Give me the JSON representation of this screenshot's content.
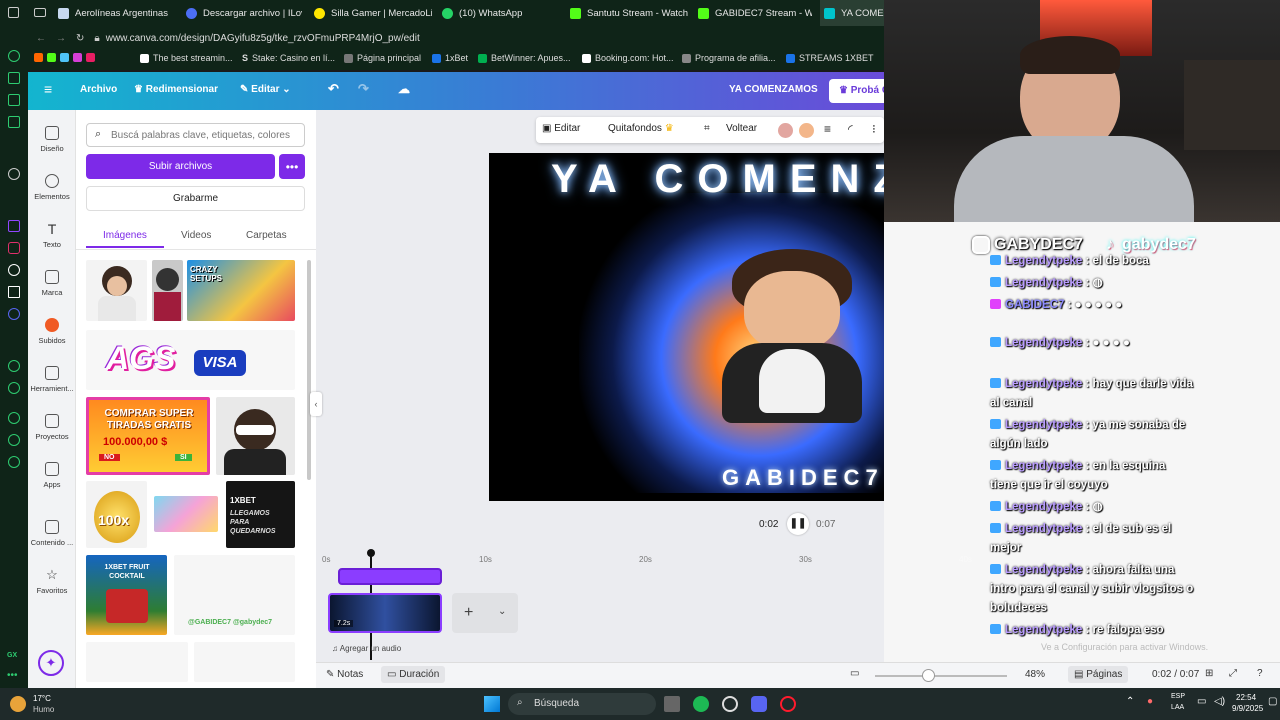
{
  "browser": {
    "tabs": [
      "Aerolíneas Argentinas",
      "Descargar archivo | ILove",
      "Silla Gamer | MercadoLib",
      "(10) WhatsApp",
      "Santutu Stream - Watch L",
      "GABIDEC7 Stream - Watc",
      "YA COMEN"
    ],
    "url": "www.canva.com/design/DAGyifu8z5g/tke_rzvOFmuPRP4MrjO_pw/edit",
    "bookmarks": [
      "The best streamin...",
      "Stake: Casino en lí...",
      "Página principal",
      "1xBet",
      "BetWinner: Apues...",
      "Booking.com: Hot...",
      "Programa de afilia...",
      "STREAMS 1XBET"
    ]
  },
  "canva": {
    "menu": {
      "file": "Archivo",
      "resize": "Redimensionar",
      "edit": "Editar"
    },
    "doc_title": "YA COMENZAMOS",
    "try_pro": "Probá C",
    "nav": [
      "Diseño",
      "Elementos",
      "Texto",
      "Marca",
      "Subidos",
      "Herramient...",
      "Proyectos",
      "Apps",
      "Contenido ...",
      "Favoritos"
    ],
    "panel": {
      "search_placeholder": "Buscá palabras clave, etiquetas, colores",
      "upload": "Subir archivos",
      "more": "•••",
      "record": "Grabarme",
      "tabs": [
        "Imágenes",
        "Videos",
        "Carpetas"
      ],
      "thumb_ags": "AGS",
      "thumb_visa": "VISA",
      "thumb_comprar": "COMPRAR SUPER TIRADAS GRATIS",
      "thumb_amount": "100.000,00 $",
      "thumb_no": "NO",
      "thumb_si": "SI",
      "thumb_100x": "100x",
      "thumb_1xbet": "1XBET",
      "thumb_llegamos": "LLEGAMOS PARA QUEDARNOS",
      "thumb_fruit": "1XBET FRUIT COCKTAIL",
      "thumb_gabydec": "@GABIDEC7   @gabydec7",
      "thumb_crazy": "CRAZY SETUPS"
    },
    "toolbar": {
      "edit": "Editar",
      "remove_bg": "Quitafondos",
      "flip": "Voltear"
    },
    "design": {
      "title": "YA COMENZ",
      "name": "GABIDEC7"
    },
    "playback": {
      "current": "0:02",
      "total": "0:07"
    },
    "timeline": {
      "ticks": [
        "0s",
        "10s",
        "20s",
        "30s",
        "40s",
        "50s"
      ],
      "clip_duration": "7.2s",
      "add_audio": "Agregar un audio"
    },
    "status": {
      "notes": "Notas",
      "duration": "Duración",
      "zoom": "48%",
      "pages": "Páginas",
      "page_time": "0:02 / 0:07"
    }
  },
  "overlay": {
    "instagram": "GABYDEC7",
    "tiktok": "gabydec7",
    "chat": [
      {
        "user": "Legendytpeke",
        "text": ": el de boca"
      },
      {
        "user": "Legendytpeke",
        "text": ":"
      },
      {
        "user": "GABIDEC7",
        "text": ":"
      },
      {
        "user": "Legendytpeke",
        "text": ":"
      },
      {
        "user": "Legendytpeke",
        "text": ": hay que darle vida al canal"
      },
      {
        "user": "Legendytpeke",
        "text": ": ya me sonaba de algún lado"
      },
      {
        "user": "Legendytpeke",
        "text": ": en la esquina tiene que ir el coyuyo"
      },
      {
        "user": "Legendytpeke",
        "text": ":"
      },
      {
        "user": "Legendytpeke",
        "text": ": el de sub es el mejor"
      },
      {
        "user": "Legendytpeke",
        "text": ": ahora falta una intro para el canal y subir vlogsitos o boludeces"
      },
      {
        "user": "Legendytpeke",
        "text": ": re falopa eso"
      }
    ],
    "watermark": "Ve a Configuración para activar Windows."
  },
  "taskbar": {
    "weather_temp": "17°C",
    "weather_desc": "Humo",
    "search": "Búsqueda",
    "lang": "ESP",
    "lang2": "LAA",
    "time": "22:54",
    "date": "9/9/2025"
  }
}
